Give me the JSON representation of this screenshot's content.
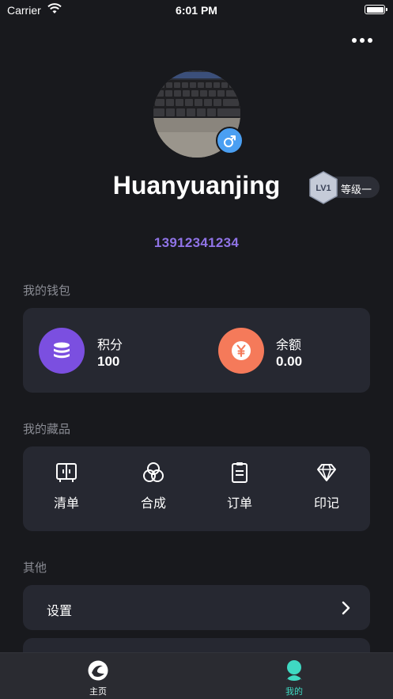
{
  "status_bar": {
    "carrier": "Carrier",
    "time": "6:01 PM",
    "wifi_icon": "wifi-icon",
    "battery_icon": "battery-icon"
  },
  "header": {
    "more_icon": "more-horizontal-icon"
  },
  "profile": {
    "avatar": "keyboard-photo",
    "gender_icon": "male-icon",
    "username": "Huanyuanjing",
    "level_badge": "LV1",
    "level_label": "等级一",
    "phone": "13912341234"
  },
  "wallet": {
    "title": "我的钱包",
    "items": [
      {
        "label": "积分",
        "value": "100",
        "icon": "database-icon",
        "color": "#7b4fe0"
      },
      {
        "label": "余额",
        "value": "0.00",
        "icon": "yen-coin-icon",
        "color": "#f57a5a"
      }
    ]
  },
  "collection": {
    "title": "我的藏品",
    "items": [
      {
        "label": "清单",
        "icon": "cabinet-icon"
      },
      {
        "label": "合成",
        "icon": "venn-circles-icon"
      },
      {
        "label": "订单",
        "icon": "clipboard-icon"
      },
      {
        "label": "印记",
        "icon": "diamond-icon"
      }
    ]
  },
  "other": {
    "title": "其他",
    "items": [
      {
        "label": "设置",
        "icon": "chevron-right-icon"
      }
    ]
  },
  "tab_bar": {
    "items": [
      {
        "label": "主页",
        "icon": "home-logo-icon",
        "active": false
      },
      {
        "label": "我的",
        "icon": "profile-icon",
        "active": true
      }
    ],
    "active_color": "#3fd9c2"
  }
}
